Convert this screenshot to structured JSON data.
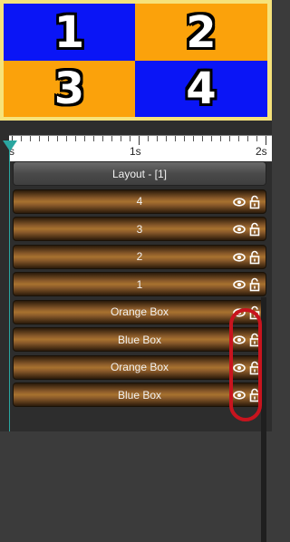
{
  "preview": {
    "cells": [
      {
        "label": "1",
        "color": "#0a15f6"
      },
      {
        "label": "2",
        "color": "#fba20b"
      },
      {
        "label": "3",
        "color": "#fba20b"
      },
      {
        "label": "4",
        "color": "#0a15f6"
      }
    ],
    "border_color": "#f6e27a"
  },
  "timeline": {
    "ruler_labels": [
      "s",
      "1s",
      "2s"
    ],
    "playhead_color": "#2aa6a0",
    "layout_track": {
      "label": "Layout - [1]"
    },
    "tracks": [
      {
        "label": "4"
      },
      {
        "label": "3"
      },
      {
        "label": "2"
      },
      {
        "label": "1"
      },
      {
        "label": "Orange Box"
      },
      {
        "label": "Blue Box"
      },
      {
        "label": "Orange Box"
      },
      {
        "label": "Blue Box"
      }
    ],
    "track_icons": [
      "eye-icon",
      "lock-icon"
    ],
    "highlight_color": "#c8141e"
  }
}
